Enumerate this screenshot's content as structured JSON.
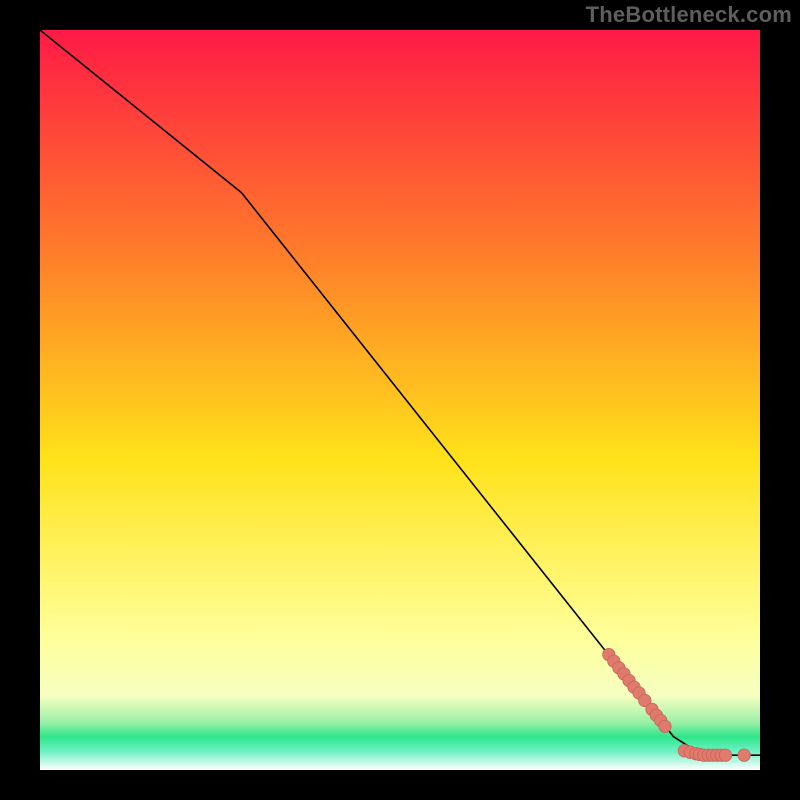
{
  "watermark": "TheBottleneck.com",
  "colors": {
    "frame_bg": "#000000",
    "line": "#000000",
    "marker_fill": "#e07a6d",
    "marker_stroke": "#c76557",
    "gradient_top": "#ff1a46",
    "gradient_mid_upper": "#ff7c2a",
    "gradient_mid": "#ffe21a",
    "gradient_lower": "#ffff9a",
    "gradient_green_band": "#2ee68a",
    "gradient_bottom": "#ffffff"
  },
  "chart_data": {
    "type": "line",
    "title": "",
    "xlabel": "",
    "ylabel": "",
    "xlim": [
      0,
      100
    ],
    "ylim": [
      0,
      100
    ],
    "line_points": [
      {
        "x": 0,
        "y": 100
      },
      {
        "x": 28,
        "y": 78
      },
      {
        "x": 88,
        "y": 4.5
      },
      {
        "x": 92,
        "y": 2.0
      },
      {
        "x": 100,
        "y": 2.0
      }
    ],
    "series": [
      {
        "name": "markers-diagonal",
        "points": [
          {
            "x": 79.0,
            "y": 15.6
          },
          {
            "x": 79.7,
            "y": 14.7
          },
          {
            "x": 80.4,
            "y": 13.8
          },
          {
            "x": 81.1,
            "y": 13.0
          },
          {
            "x": 81.8,
            "y": 12.1
          },
          {
            "x": 82.5,
            "y": 11.2
          },
          {
            "x": 83.2,
            "y": 10.4
          },
          {
            "x": 84.0,
            "y": 9.4
          },
          {
            "x": 85.0,
            "y": 8.2
          },
          {
            "x": 85.6,
            "y": 7.4
          },
          {
            "x": 86.2,
            "y": 6.7
          },
          {
            "x": 86.8,
            "y": 5.9
          }
        ]
      },
      {
        "name": "markers-flat",
        "points": [
          {
            "x": 89.5,
            "y": 2.6
          },
          {
            "x": 90.3,
            "y": 2.4
          },
          {
            "x": 91.1,
            "y": 2.2
          },
          {
            "x": 91.6,
            "y": 2.1
          },
          {
            "x": 92.2,
            "y": 2.0
          },
          {
            "x": 92.8,
            "y": 2.0
          },
          {
            "x": 93.4,
            "y": 2.0
          },
          {
            "x": 94.0,
            "y": 2.0
          },
          {
            "x": 94.6,
            "y": 2.0
          },
          {
            "x": 95.2,
            "y": 2.0
          },
          {
            "x": 97.8,
            "y": 2.0
          }
        ]
      }
    ],
    "background_gradient": {
      "stops": [
        {
          "offset": 0.0,
          "color": "#ff1a46"
        },
        {
          "offset": 0.3,
          "color": "#ff7c2a"
        },
        {
          "offset": 0.58,
          "color": "#ffe21a"
        },
        {
          "offset": 0.82,
          "color": "#ffff9a"
        },
        {
          "offset": 0.9,
          "color": "#f5ffc0"
        },
        {
          "offset": 0.935,
          "color": "#9df0a8"
        },
        {
          "offset": 0.955,
          "color": "#2ee68a"
        },
        {
          "offset": 0.975,
          "color": "#6ef0c4"
        },
        {
          "offset": 1.0,
          "color": "#ffffff"
        }
      ]
    }
  }
}
